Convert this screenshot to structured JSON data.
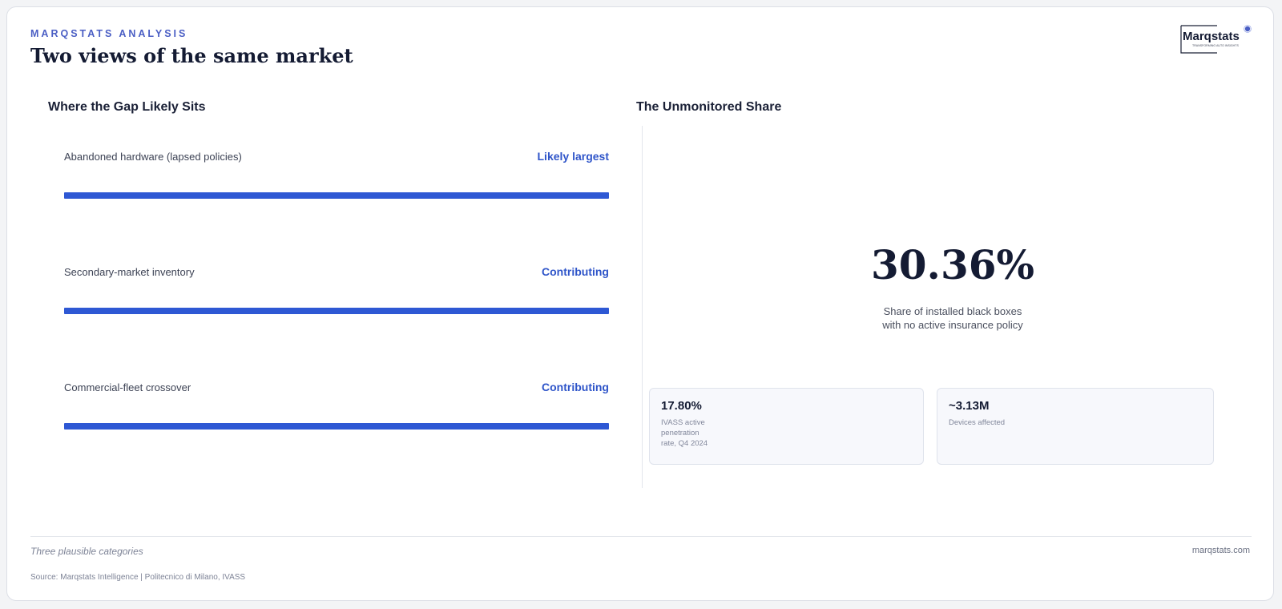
{
  "header": {
    "eyebrow": "MARQSTATS ANALYSIS",
    "title": "Two views of the same market",
    "logo_text": "Marqstats",
    "logo_tagline": "TRANSFORMING AUTO INSIGHTS"
  },
  "left_panel": {
    "title": "Where the Gap Likely Sits",
    "rows": [
      {
        "label": "Abandoned hardware (lapsed policies)",
        "status": "Likely largest",
        "level": 1.0
      },
      {
        "label": "Secondary-market inventory",
        "status": "Contributing",
        "level": 1.0
      },
      {
        "label": "Commercial-fleet crossover",
        "status": "Contributing",
        "level": 1.0
      }
    ]
  },
  "right_panel": {
    "title": "The Unmonitored Share",
    "big_value": "30.36%",
    "caption_line1": "Share of installed black boxes",
    "caption_line2": "with no active insurance policy",
    "cards": [
      {
        "value": "17.80%",
        "label": "IVASS active penetration rate, Q4 2024"
      },
      {
        "value": "~3.13M",
        "label": "Devices affected"
      }
    ]
  },
  "footer": {
    "note": "Three plausible categories",
    "site": "marqstats.com",
    "source": "Source: Marqstats Intelligence | Politecnico di Milano, IVASS"
  },
  "colors": {
    "accent": "#2e58d4",
    "status_text": "#2f55c9",
    "title_text": "#141b33",
    "eyebrow": "#4a5ec4"
  }
}
